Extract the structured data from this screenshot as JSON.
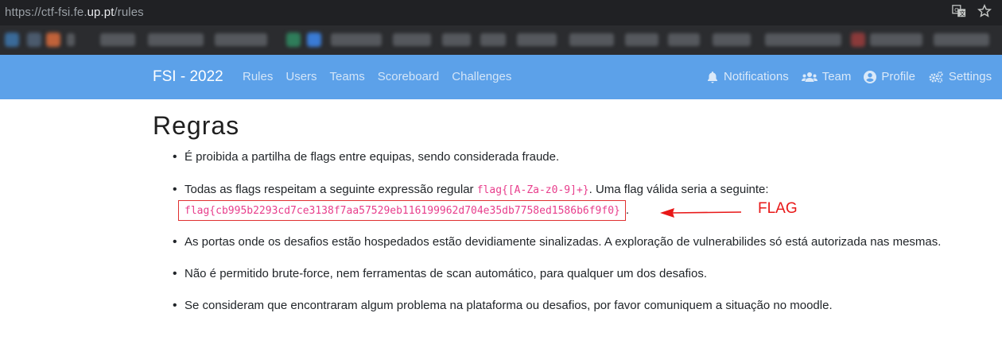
{
  "browser": {
    "url_prefix": "https://ctf-fsi.fe.",
    "url_host": "up.pt",
    "url_path": "/rules",
    "icons": [
      "translate-icon",
      "star-icon"
    ]
  },
  "navbar": {
    "brand": "FSI - 2022",
    "links": [
      "Rules",
      "Users",
      "Teams",
      "Scoreboard",
      "Challenges"
    ],
    "right": {
      "notifications": "Notifications",
      "team": "Team",
      "profile": "Profile",
      "settings": "Settings"
    },
    "color": "#5ca1e9"
  },
  "page": {
    "title": "Regras",
    "rules": {
      "r1": "É proibida a partilha de flags entre equipas, sendo considerada fraude.",
      "r2_before": "Todas as flags respeitam a seguinte expressão regular ",
      "r2_code": "flag{[A-Za-z0-9]+}",
      "r2_after": ". Uma flag válida seria a seguinte:",
      "r2_flag": "flag{cb995b2293cd7ce3138f7aa57529eb116199962d704e35db7758ed1586b6f9f0}",
      "r2_end": ".",
      "r3": "As portas onde os desafios estão hospedados estão devidiamente sinalizadas. A exploração de vulnerabilides só está autorizada nas mesmas.",
      "r4": "Não é permitido brute-force, nem ferramentas de scan automático, para qualquer um dos desafios.",
      "r5": "Se consideram que encontraram algum problema na plataforma ou desafios, por favor comuniquem a situação no moodle."
    }
  },
  "annotation": {
    "label": "FLAG",
    "color": "#e81818"
  }
}
